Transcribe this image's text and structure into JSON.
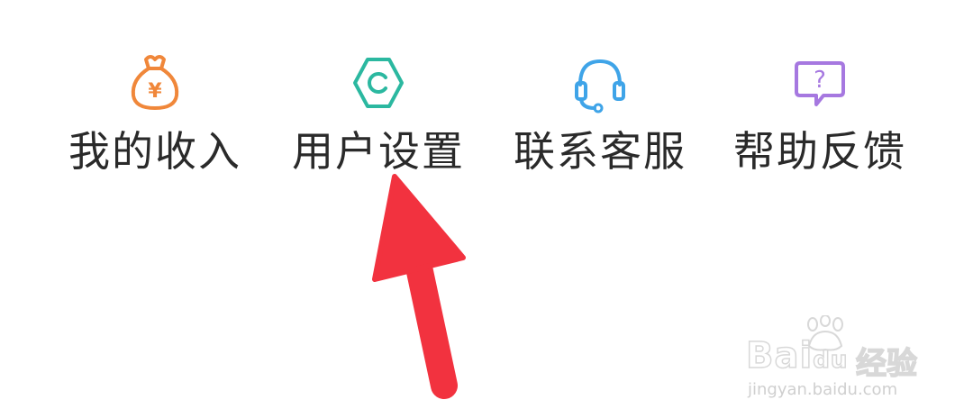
{
  "menu": {
    "items": [
      {
        "label": "我的收入",
        "icon": "money-bag-icon",
        "color": "#F0873A"
      },
      {
        "label": "用户设置",
        "icon": "settings-hexagon-icon",
        "color": "#2BB8A0"
      },
      {
        "label": "联系客服",
        "icon": "headset-icon",
        "color": "#3FA4E8"
      },
      {
        "label": "帮助反馈",
        "icon": "help-bubble-icon",
        "color": "#A678E0"
      }
    ]
  },
  "money_icon_glyph": "¥",
  "help_icon_glyph": "?",
  "annotation": {
    "arrow_color": "#F2323F"
  },
  "watermark": {
    "brand": "Bai",
    "brand_suffix": "du",
    "suffix_cn": "经验",
    "url": "jingyan.baidu.com"
  }
}
